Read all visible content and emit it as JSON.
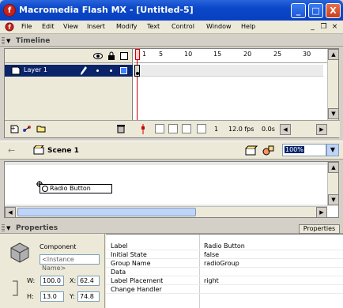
{
  "window": {
    "title": "Macromedia Flash MX - [Untitled-5]",
    "app_icon": "flash-icon",
    "controls": [
      "_",
      "□",
      "X"
    ]
  },
  "menu": {
    "items": [
      "File",
      "Edit",
      "View",
      "Insert",
      "Modify",
      "Text",
      "Control",
      "Window",
      "Help"
    ],
    "mdi": [
      "_",
      "❐",
      "×"
    ]
  },
  "timeline": {
    "header": "Timeline",
    "layer_name": "Layer 1",
    "ruler": [
      "1",
      "5",
      "10",
      "15",
      "20",
      "25",
      "30"
    ],
    "current_frame": "1",
    "fps": "12.0 fps",
    "time": "0.0s"
  },
  "scene": {
    "label": "Scene 1",
    "zoom": "100%"
  },
  "stage": {
    "component_label": "Radio Button"
  },
  "properties": {
    "header": "Properties",
    "tab_label": "Properties",
    "component_type": "Component",
    "instance_placeholder": "<Instance Name>",
    "w_label": "W:",
    "w_value": "100.0",
    "x_label": "X:",
    "x_value": "62.4",
    "h_label": "H:",
    "h_value": "13.0",
    "y_label": "Y:",
    "y_value": "74.8",
    "params": [
      {
        "name": "Label",
        "value": "Radio Button"
      },
      {
        "name": "Initial State",
        "value": "false"
      },
      {
        "name": "Group Name",
        "value": "radioGroup"
      },
      {
        "name": "Data",
        "value": ""
      },
      {
        "name": "Label Placement",
        "value": "right"
      },
      {
        "name": "Change Handler",
        "value": ""
      }
    ]
  },
  "colors": {
    "title_bar": "#0a48c8",
    "selection": "#0a246a",
    "playhead": "#cc0000",
    "panel_bg": "#ece9d8"
  }
}
